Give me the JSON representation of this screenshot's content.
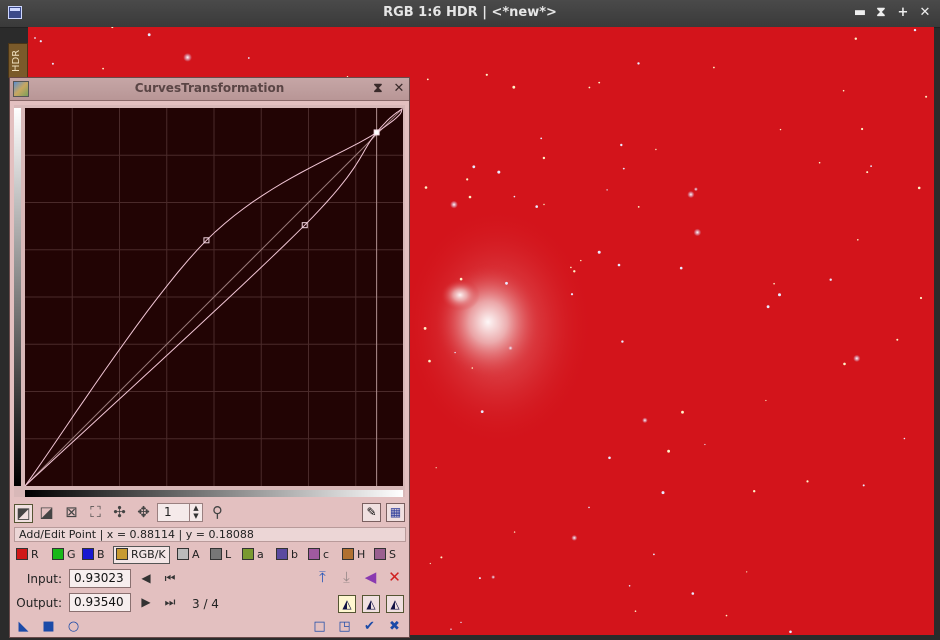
{
  "window": {
    "title": "RGB 1:6 HDR | <*new*>",
    "minimize_glyph": "▬",
    "shade_glyph": "⧗",
    "maximize_glyph": "+",
    "close_glyph": "✕"
  },
  "side_tab": {
    "label": "HDR"
  },
  "image": {
    "background_color": "#d3141b"
  },
  "dialog": {
    "title": "CurvesTransformation",
    "shade_glyph": "⧗",
    "close_glyph": "✕",
    "curve": {
      "points_rgbk": [
        [
          0,
          0
        ],
        [
          0.48,
          0.65
        ],
        [
          0.93023,
          0.9354
        ],
        [
          1,
          1
        ]
      ],
      "points_alt": [
        [
          0,
          0
        ],
        [
          0.74,
          0.69
        ],
        [
          0.93023,
          0.9354
        ],
        [
          1,
          1
        ]
      ],
      "curve_color": "#f2c6d6",
      "background_color": "#220404",
      "grid_color": "#4a2a2a"
    },
    "toolbar": {
      "edit_point_icon": "edit-point-icon",
      "select_point_icon": "select-point-icon",
      "delete_point_icon": "delete-point-icon",
      "zoom_fit_icon": "zoom-fit-icon",
      "zoom_1_1_icon": "zoom-1-1-icon",
      "pan_icon": "pan-icon",
      "zoom_level": "1",
      "zoom_icon": "zoom-icon",
      "show_all_curves_icon": "show-all-curves-icon",
      "show_grid_icon": "show-grid-icon"
    },
    "status": "Add/Edit Point | x = 0.88114 | y = 0.18088",
    "channels": [
      {
        "key": "R",
        "label": "R",
        "color": "#d01818"
      },
      {
        "key": "G",
        "label": "G",
        "color": "#18b818"
      },
      {
        "key": "B",
        "label": "B",
        "color": "#1818d0"
      },
      {
        "key": "RGBK",
        "label": "RGB/K",
        "color": "#c89a30"
      },
      {
        "key": "A",
        "label": "A",
        "color": "#bbbbbb"
      },
      {
        "key": "L",
        "label": "L",
        "color": "#777777"
      },
      {
        "key": "a",
        "label": "a",
        "color": "#7a9a30"
      },
      {
        "key": "b",
        "label": "b",
        "color": "#5a4aa0"
      },
      {
        "key": "c",
        "label": "c",
        "color": "#a05aa0"
      },
      {
        "key": "H",
        "label": "H",
        "color": "#b07030"
      },
      {
        "key": "S",
        "label": "S",
        "color": "#9a6090"
      }
    ],
    "selected_channel": "RGB/K",
    "input_label": "Input:",
    "input_value": "0.93023",
    "output_label": "Output:",
    "output_value": "0.93540",
    "point_index": "3 / 4"
  }
}
